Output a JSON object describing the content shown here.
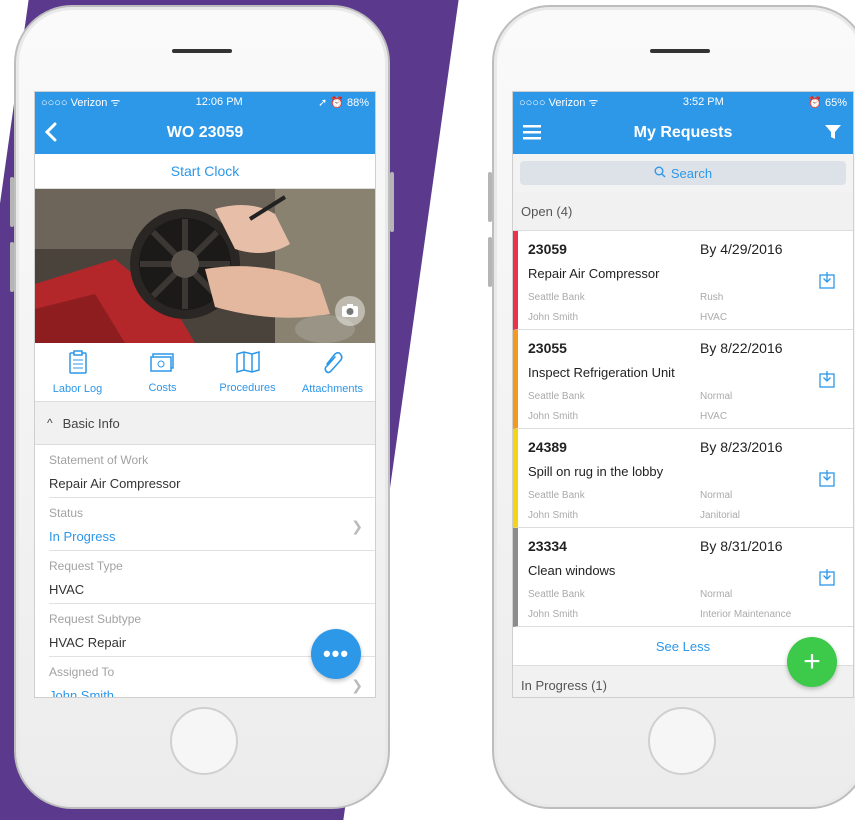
{
  "colors": {
    "accent": "#2d97e8",
    "purple_bg": "#5b3a8e",
    "fab_green": "#3dc94a"
  },
  "left": {
    "status": {
      "carrier": "○○○○ Verizon ᯤ",
      "time": "12:06 PM",
      "battery": "➚ ⏰ 88%"
    },
    "nav_title": "WO 23059",
    "start_clock": "Start Clock",
    "tabs": [
      {
        "label": "Labor Log",
        "icon": "clipboard-icon"
      },
      {
        "label": "Costs",
        "icon": "money-icon"
      },
      {
        "label": "Procedures",
        "icon": "map-icon"
      },
      {
        "label": "Attachments",
        "icon": "paperclip-icon"
      }
    ],
    "section": {
      "caret": "^",
      "label": "Basic Info"
    },
    "fields": [
      {
        "label": "Statement of Work",
        "value": "Repair Air Compressor"
      },
      {
        "label": "Status",
        "value": "In Progress"
      },
      {
        "label": "Request Type",
        "value": "HVAC"
      },
      {
        "label": "Request Subtype",
        "value": "HVAC Repair"
      },
      {
        "label": "Assigned To",
        "value": "John Smith"
      }
    ],
    "fab": "•••"
  },
  "right": {
    "status": {
      "carrier": "○○○○ Verizon ᯤ",
      "time": "3:52 PM",
      "battery": "⏰ 65%"
    },
    "nav_title": "My Requests",
    "search": "Search",
    "open_header": "Open (4)",
    "requests": [
      {
        "id": "23059",
        "due": "By 4/29/2016",
        "title": "Repair Air Compressor",
        "site": "Seattle Bank",
        "person": "John Smith",
        "priority": "Rush",
        "trade": "HVAC",
        "color": "#e8334a"
      },
      {
        "id": "23055",
        "due": "By 8/22/2016",
        "title": "Inspect Refrigeration Unit",
        "site": "Seattle Bank",
        "person": "John Smith",
        "priority": "Normal",
        "trade": "HVAC",
        "color": "#f39a1e"
      },
      {
        "id": "24389",
        "due": "By 8/23/2016",
        "title": "Spill on rug in the lobby",
        "site": "Seattle Bank",
        "person": "John Smith",
        "priority": "Normal",
        "trade": "Janitorial",
        "color": "#f5d317"
      },
      {
        "id": "23334",
        "due": "By 8/31/2016",
        "title": "Clean windows",
        "site": "Seattle Bank",
        "person": "John Smith",
        "priority": "Normal",
        "trade": "Interior Maintenance",
        "color": "#8c8c8c"
      }
    ],
    "see_less": "See Less",
    "in_progress_header": "In Progress (1)",
    "fab": "+"
  }
}
